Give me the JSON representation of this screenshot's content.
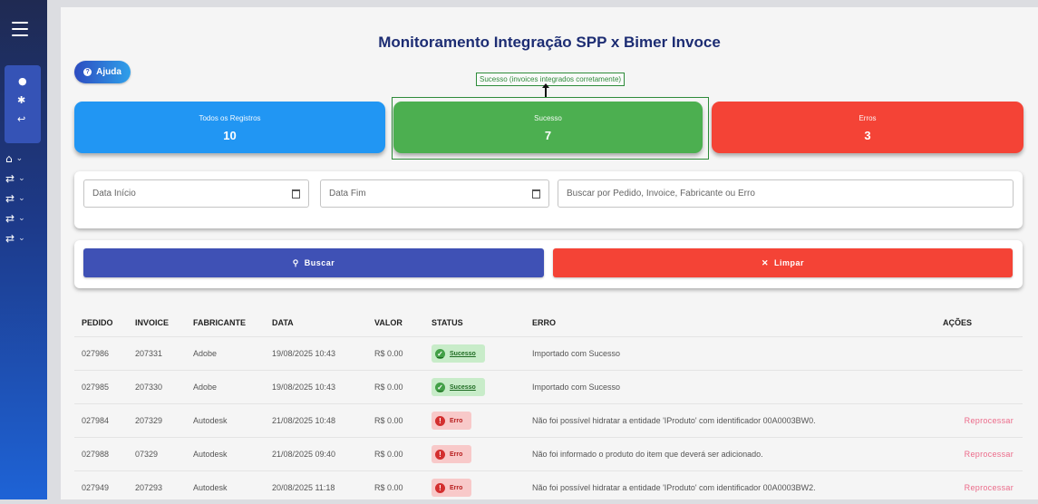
{
  "title": "Monitoramento Integração SPP x Bimer Invoce",
  "help_label": "Ajuda",
  "tooltip": "Sucesso (invoices integrados corretamente)",
  "cards": {
    "total": {
      "label": "Todos os Registros",
      "value": "10"
    },
    "ok": {
      "label": "Sucesso",
      "value": "7"
    },
    "err": {
      "label": "Erros",
      "value": "3"
    }
  },
  "filters": {
    "start_placeholder": "Data Início",
    "end_placeholder": "Data Fim",
    "search_placeholder": "Buscar por Pedido, Invoice, Fabricante ou Erro"
  },
  "buttons": {
    "search": "Buscar",
    "clear": "Limpar"
  },
  "columns": [
    "PEDIDO",
    "INVOICE",
    "FABRICANTE",
    "DATA",
    "VALOR",
    "STATUS",
    "ERRO",
    "AÇÕES"
  ],
  "rows": [
    {
      "pedido": "027986",
      "invoice": "207331",
      "fabricante": "Adobe",
      "data": "19/08/2025 10:43",
      "valor": "R$ 0.00",
      "status": "Sucesso",
      "erro": "Importado com Sucesso",
      "acao": ""
    },
    {
      "pedido": "027985",
      "invoice": "207330",
      "fabricante": "Adobe",
      "data": "19/08/2025 10:43",
      "valor": "R$ 0.00",
      "status": "Sucesso",
      "erro": "Importado com Sucesso",
      "acao": ""
    },
    {
      "pedido": "027984",
      "invoice": "207329",
      "fabricante": "Autodesk",
      "data": "21/08/2025 10:48",
      "valor": "R$ 0.00",
      "status": "Erro",
      "erro": "Não foi possível hidratar a entidade 'IProduto' com identificador 00A0003BW0.",
      "acao": "Reprocessar"
    },
    {
      "pedido": "027988",
      "invoice": "07329",
      "fabricante": "Autodesk",
      "data": "21/08/2025 09:40",
      "valor": "R$ 0.00",
      "status": "Erro",
      "erro": "Não foi informado o produto do item que deverá ser adicionado.",
      "acao": "Reprocessar"
    },
    {
      "pedido": "027949",
      "invoice": "207293",
      "fabricante": "Autodesk",
      "data": "20/08/2025 11:18",
      "valor": "R$ 0.00",
      "status": "Erro",
      "erro": "Não foi possível hidratar a entidade 'IProduto' com identificador 00A0003BW2.",
      "acao": "Reprocessar"
    }
  ],
  "colors": {
    "accent": "#3f51b5",
    "success": "#4caf50",
    "error": "#f44336",
    "info": "#2196f3"
  }
}
